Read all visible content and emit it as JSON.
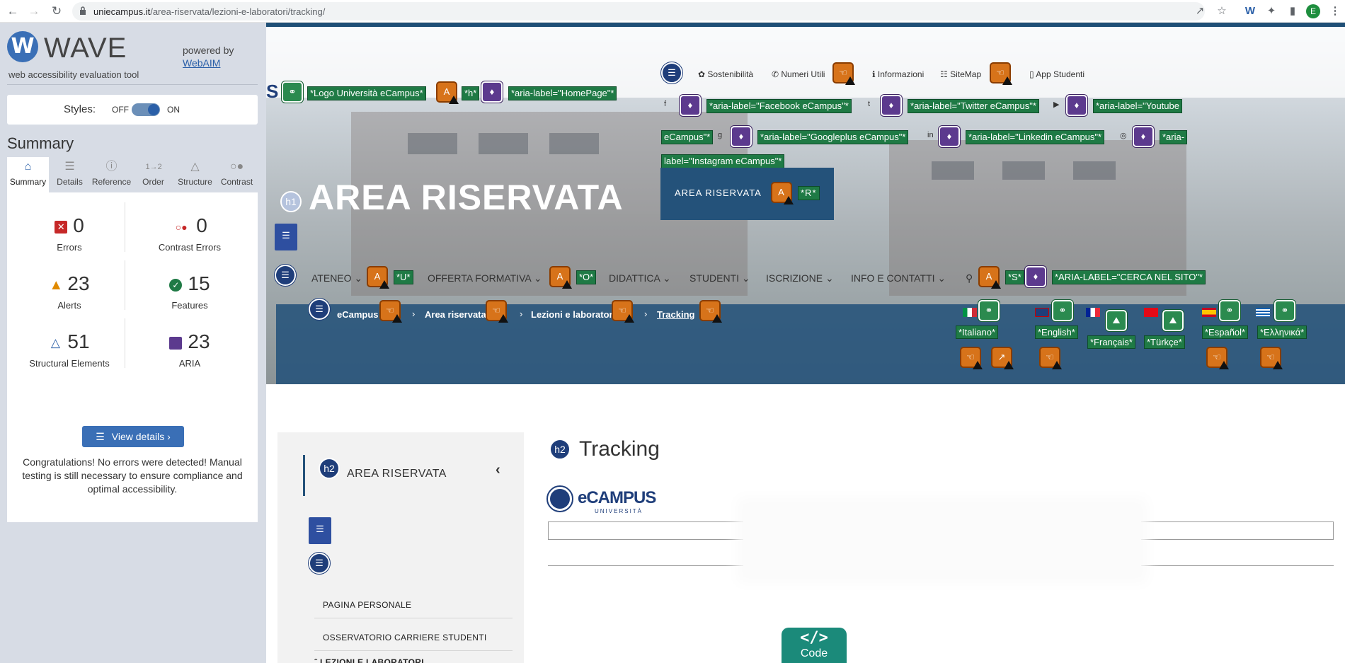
{
  "browser": {
    "url_domain": "uniecampus.it",
    "url_path": "/area-riservata/lezioni-e-laboratori/tracking/",
    "profile_initial": "E"
  },
  "wave": {
    "logo_letter": "W",
    "title": "WAVE",
    "subtitle": "web accessibility evaluation tool",
    "powered_by": "powered by",
    "webaim": "WebAIM",
    "styles_label": "Styles:",
    "styles_off": "OFF",
    "styles_on": "ON",
    "summary_heading": "Summary",
    "tabs": [
      {
        "label": "Summary",
        "icon": "home-icon"
      },
      {
        "label": "Details",
        "icon": "list-icon"
      },
      {
        "label": "Reference",
        "icon": "info-icon"
      },
      {
        "label": "Order",
        "icon": "order-icon"
      },
      {
        "label": "Structure",
        "icon": "structure-icon"
      },
      {
        "label": "Contrast",
        "icon": "contrast-icon"
      }
    ],
    "stats": {
      "errors": {
        "value": "0",
        "label": "Errors"
      },
      "contrast": {
        "value": "0",
        "label": "Contrast Errors"
      },
      "alerts": {
        "value": "23",
        "label": "Alerts"
      },
      "features": {
        "value": "15",
        "label": "Features"
      },
      "structural": {
        "value": "51",
        "label": "Structural Elements"
      },
      "aria": {
        "value": "23",
        "label": "ARIA"
      }
    },
    "view_details": "View details ›",
    "congrats": "Congratulations! No errors were detected! Manual testing is still necessary to ensure compliance and optimal accessibility."
  },
  "site": {
    "utility_links": [
      "Sostenibilità",
      "Numeri Utili",
      "Informazioni",
      "SiteMap",
      "App Studenti"
    ],
    "logo_labels": [
      "*Logo Università eCampus*",
      "*h*",
      "*aria-label=\"HomePage\"*"
    ],
    "social_labels": [
      "*aria-label=\"Facebook eCampus\"*",
      "*aria-label=\"Twitter eCampus\"*",
      "*aria-label=\"Youtube",
      "eCampus\"*",
      "*aria-label=\"Googleplus eCampus\"*",
      "*aria-label=\"Linkedin eCampus\"*",
      "*aria-",
      "label=\"Instagram eCampus\"*"
    ],
    "h1_badge": "h1",
    "h1_title": "AREA RISERVATA",
    "area_button": "AREA RISERVATA",
    "area_button_label": "*R*",
    "menu": [
      {
        "label": "ATENEO",
        "tag": "*U*"
      },
      {
        "label": "OFFERTA FORMATIVA",
        "tag": "*O*"
      },
      {
        "label": "DIDATTICA",
        "tag": ""
      },
      {
        "label": "STUDENTI",
        "tag": ""
      },
      {
        "label": "ISCRIZIONE",
        "tag": ""
      },
      {
        "label": "INFO E CONTATTI",
        "tag": ""
      }
    ],
    "search_tag": "*S*",
    "search_aria": "*ARIA-LABEL=\"CERCA NEL SITO\"*",
    "breadcrumb": [
      "eCampus",
      "Area riservata",
      "Lezioni e laboratori",
      "Tracking"
    ],
    "languages": [
      "*Italiano*",
      "*English*",
      "*Français*",
      "*Türkçe*",
      "*Español*",
      "*Ελληνικά*"
    ],
    "h2_badge": "h2",
    "side_title": "AREA RISERVATA",
    "side_items": [
      "PAGINA PERSONALE",
      "OSSERVATORIO CARRIERE STUDENTI",
      "LEZIONI E LABORATORI"
    ],
    "page_title": "Tracking",
    "ecampus_word": "eCAMPUS",
    "ecampus_uni": "UNIVERSITÀ",
    "code_label": "Code",
    "code_symbol": "</>"
  }
}
